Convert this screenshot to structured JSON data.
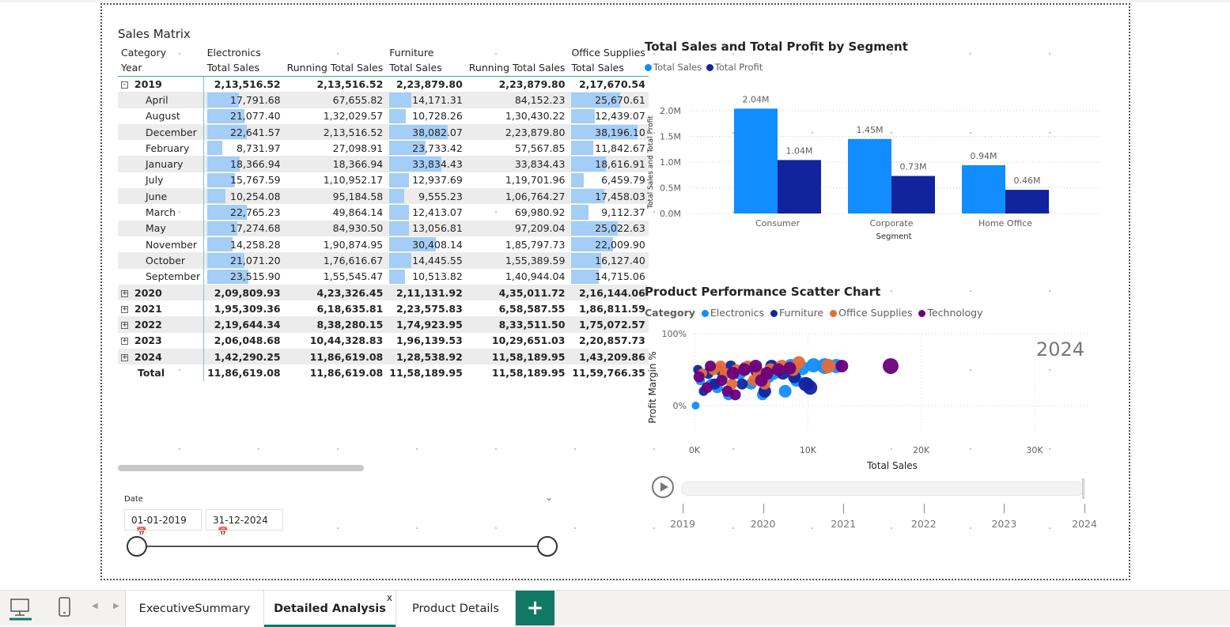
{
  "matrix": {
    "title": "Sales Matrix",
    "header_row1": [
      "Category",
      "Electronics",
      "",
      "Furniture",
      "",
      "Office Supplies"
    ],
    "header_row2": [
      "Year",
      "Total Sales",
      "Running Total Sales",
      "Total Sales",
      "Running Total Sales",
      "Total Sales"
    ],
    "year_2019": {
      "label": "2019",
      "values": [
        "2,13,516.52",
        "2,13,516.52",
        "2,23,879.80",
        "2,23,879.80",
        "2,17,670.54"
      ]
    },
    "months": [
      {
        "label": "April",
        "values": [
          "17,791.68",
          "67,655.82",
          "14,171.31",
          "84,152.23",
          "25,670.61"
        ],
        "bars": [
          0.45,
          0.33,
          0.73
        ]
      },
      {
        "label": "August",
        "values": [
          "21,077.40",
          "1,32,029.57",
          "10,728.26",
          "1,30,430.22",
          "12,439.07"
        ],
        "bars": [
          0.53,
          0.25,
          0.35
        ]
      },
      {
        "label": "December",
        "values": [
          "22,641.57",
          "2,13,516.52",
          "38,082.07",
          "2,23,879.80",
          "38,196.10"
        ],
        "bars": [
          0.57,
          0.88,
          1.0
        ]
      },
      {
        "label": "February",
        "values": [
          "8,731.97",
          "27,098.91",
          "23,733.42",
          "57,567.85",
          "11,842.67"
        ],
        "bars": [
          0.22,
          0.55,
          0.33
        ]
      },
      {
        "label": "January",
        "values": [
          "18,366.94",
          "18,366.94",
          "33,834.43",
          "33,834.43",
          "18,616.91"
        ],
        "bars": [
          0.46,
          0.78,
          0.52
        ]
      },
      {
        "label": "July",
        "values": [
          "15,767.59",
          "1,10,952.17",
          "12,937.69",
          "1,19,701.96",
          "6,459.79"
        ],
        "bars": [
          0.4,
          0.3,
          0.18
        ]
      },
      {
        "label": "June",
        "values": [
          "10,254.08",
          "95,184.58",
          "9,555.23",
          "1,06,764.27",
          "17,458.03"
        ],
        "bars": [
          0.26,
          0.22,
          0.49
        ]
      },
      {
        "label": "March",
        "values": [
          "22,765.23",
          "49,864.14",
          "12,413.07",
          "69,980.92",
          "9,112.37"
        ],
        "bars": [
          0.57,
          0.29,
          0.26
        ]
      },
      {
        "label": "May",
        "values": [
          "17,274.68",
          "84,930.50",
          "13,056.81",
          "97,209.04",
          "25,022.63"
        ],
        "bars": [
          0.43,
          0.3,
          0.7
        ]
      },
      {
        "label": "November",
        "values": [
          "14,258.28",
          "1,90,874.95",
          "30,408.14",
          "1,85,797.73",
          "22,009.90"
        ],
        "bars": [
          0.36,
          0.7,
          0.62
        ]
      },
      {
        "label": "October",
        "values": [
          "21,071.20",
          "1,76,616.67",
          "14,445.55",
          "1,55,389.59",
          "16,127.40"
        ],
        "bars": [
          0.53,
          0.33,
          0.45
        ]
      },
      {
        "label": "September",
        "values": [
          "23,515.90",
          "1,55,545.47",
          "10,513.82",
          "1,40,944.04",
          "14,715.06"
        ],
        "bars": [
          0.59,
          0.24,
          0.41
        ]
      }
    ],
    "years": [
      {
        "label": "2020",
        "values": [
          "2,09,809.93",
          "4,23,326.45",
          "2,11,131.92",
          "4,35,011.72",
          "2,16,144.06"
        ]
      },
      {
        "label": "2021",
        "values": [
          "1,95,309.36",
          "6,18,635.81",
          "2,23,575.83",
          "6,58,587.55",
          "1,86,811.59"
        ]
      },
      {
        "label": "2022",
        "values": [
          "2,19,644.34",
          "8,38,280.15",
          "1,74,923.95",
          "8,33,511.50",
          "1,75,072.57"
        ]
      },
      {
        "label": "2023",
        "values": [
          "2,06,048.68",
          "10,44,328.83",
          "1,96,139.53",
          "10,29,651.03",
          "2,20,857.73"
        ]
      },
      {
        "label": "2024",
        "values": [
          "1,42,290.25",
          "11,86,619.08",
          "1,28,538.92",
          "11,58,189.95",
          "1,43,209.86"
        ]
      }
    ],
    "total": {
      "label": "Total",
      "values": [
        "11,86,619.08",
        "11,86,619.08",
        "11,58,189.95",
        "11,58,189.95",
        "11,59,766.35"
      ]
    },
    "expand_collapse_symbol": "⊟",
    "expand_symbol": "⊞",
    "bar_color": "#a4cdf8"
  },
  "slicer": {
    "label": "Date",
    "start": "01-01-2019",
    "end": "31-12-2024",
    "chevron": "⌄",
    "calendar_icon": "calendar-icon"
  },
  "bar_chart": {
    "title": "Total Sales and Total Profit by Segment",
    "legend": [
      "Total Sales",
      "Total Profit"
    ]
  },
  "scatter_chart": {
    "title": "Product Performance Scatter Chart",
    "legend_title": "Category",
    "legend": [
      "Electronics",
      "Furniture",
      "Office Supplies",
      "Technology"
    ],
    "watermark": "2024"
  },
  "play_axis": {
    "years": [
      "2019",
      "2020",
      "2021",
      "2022",
      "2023",
      "2024"
    ]
  },
  "tabs": {
    "items": [
      "ExecutiveSummary",
      "Detailed Analysis",
      "Product Details"
    ],
    "close": "x",
    "add": "+"
  },
  "colors": {
    "total_sales": "#118dff",
    "total_profit": "#12239e",
    "electronics": "#118dff",
    "furniture": "#12239e",
    "office_supplies": "#e66c37",
    "technology": "#6b007b",
    "accent": "#117865"
  },
  "chart_data": [
    {
      "type": "bar",
      "title": "Total Sales and Total Profit by Segment",
      "categories": [
        "Consumer",
        "Corporate",
        "Home Office"
      ],
      "series": [
        {
          "name": "Total Sales",
          "values": [
            2.04,
            1.45,
            0.94
          ],
          "labels": [
            "2.04M",
            "1.45M",
            "0.94M"
          ]
        },
        {
          "name": "Total Profit",
          "values": [
            1.04,
            0.73,
            0.46
          ],
          "labels": [
            "1.04M",
            "0.73M",
            "0.46M"
          ]
        }
      ],
      "xlabel": "Segment",
      "ylabel": "Total Sales and Total Profit",
      "ylim": [
        0,
        2.0
      ],
      "yticks": [
        "0.0M",
        "0.5M",
        "1.0M",
        "1.5M",
        "2.0M"
      ],
      "legend_placement": "top-left",
      "grid": true
    },
    {
      "type": "scatter",
      "title": "Product Performance Scatter Chart",
      "xlabel": "Total Sales",
      "ylabel": "Profit Margin %",
      "xticks": [
        "0K",
        "10K",
        "20K",
        "30K"
      ],
      "yticks": [
        "0%",
        "100%"
      ],
      "xlim": [
        0,
        35000
      ],
      "ylim": [
        -0.3,
        1.0
      ],
      "legend_placement": "top-left",
      "series": [
        {
          "name": "Electronics",
          "points": [
            [
              500,
              0.35
            ],
            [
              1500,
              0.3
            ],
            [
              2500,
              0.4
            ],
            [
              4000,
              0.45
            ],
            [
              5000,
              0.3
            ],
            [
              6500,
              0.4
            ],
            [
              7500,
              0.5
            ],
            [
              8500,
              0.55
            ],
            [
              9500,
              0.52
            ],
            [
              10500,
              0.56
            ],
            [
              11500,
              0.55
            ],
            [
              8000,
              0.2
            ],
            [
              6000,
              0.15
            ],
            [
              3000,
              0.15
            ],
            [
              2000,
              0.25
            ],
            [
              9000,
              0.35
            ],
            [
              10000,
              0.3
            ],
            [
              7000,
              0.45
            ],
            [
              100,
              0.0
            ],
            [
              12500,
              0.55
            ]
          ],
          "sizes": [
            6,
            7,
            7,
            8,
            7,
            8,
            8,
            9,
            9,
            9,
            10,
            8,
            7,
            7,
            7,
            8,
            8,
            8,
            5,
            9
          ]
        },
        {
          "name": "Furniture",
          "points": [
            [
              300,
              0.5
            ],
            [
              1200,
              0.45
            ],
            [
              2200,
              0.5
            ],
            [
              3200,
              0.55
            ],
            [
              4500,
              0.52
            ],
            [
              5500,
              0.48
            ],
            [
              6800,
              0.55
            ],
            [
              7800,
              0.45
            ],
            [
              8800,
              0.4
            ],
            [
              9800,
              0.3
            ],
            [
              10200,
              0.25
            ],
            [
              1800,
              0.3
            ],
            [
              4200,
              0.3
            ],
            [
              6200,
              0.2
            ],
            [
              800,
              0.2
            ]
          ],
          "sizes": [
            6,
            7,
            7,
            7,
            8,
            8,
            8,
            8,
            8,
            9,
            9,
            7,
            7,
            8,
            6
          ]
        },
        {
          "name": "Office Supplies",
          "points": [
            [
              700,
              0.45
            ],
            [
              1700,
              0.5
            ],
            [
              2700,
              0.45
            ],
            [
              3700,
              0.5
            ],
            [
              4700,
              0.55
            ],
            [
              5700,
              0.45
            ],
            [
              6700,
              0.5
            ],
            [
              7700,
              0.55
            ],
            [
              8700,
              0.5
            ],
            [
              9200,
              0.6
            ],
            [
              11800,
              0.55
            ],
            [
              5200,
              0.35
            ],
            [
              3300,
              0.3
            ],
            [
              2300,
              0.55
            ],
            [
              6200,
              0.3
            ]
          ],
          "sizes": [
            6,
            7,
            7,
            7,
            7,
            8,
            8,
            8,
            8,
            8,
            9,
            7,
            7,
            7,
            7
          ]
        },
        {
          "name": "Technology",
          "points": [
            [
              400,
              0.4
            ],
            [
              1400,
              0.55
            ],
            [
              2400,
              0.35
            ],
            [
              3400,
              0.45
            ],
            [
              4400,
              0.5
            ],
            [
              5400,
              0.55
            ],
            [
              6400,
              0.45
            ],
            [
              7400,
              0.5
            ],
            [
              8400,
              0.52
            ],
            [
              13000,
              0.55
            ],
            [
              17300,
              0.55
            ],
            [
              2900,
              0.2
            ],
            [
              3600,
              0.15
            ],
            [
              5900,
              0.35
            ],
            [
              1100,
              0.25
            ]
          ],
          "sizes": [
            7,
            7,
            7,
            8,
            8,
            8,
            8,
            8,
            8,
            8,
            10,
            7,
            7,
            8,
            7
          ]
        }
      ]
    }
  ]
}
